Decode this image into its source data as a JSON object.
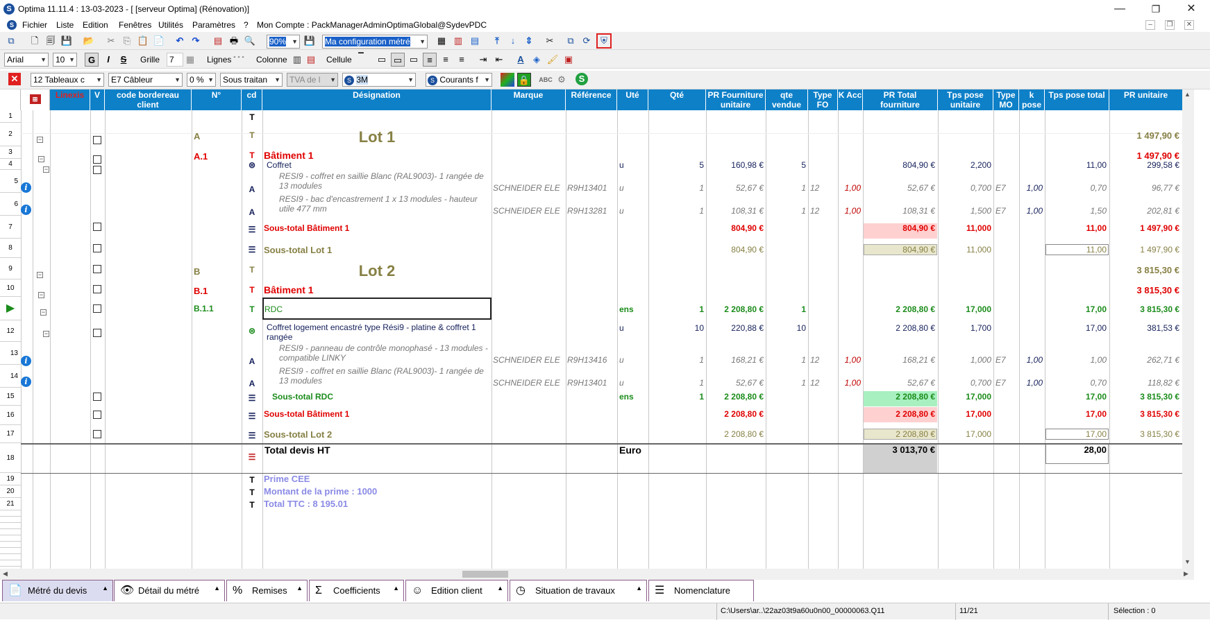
{
  "window": {
    "title": "Optima 11.11.4 : 13-03-2023 - [ [serveur Optima] (Rénovation)]",
    "minimize": "—",
    "maximize": "❐",
    "close": "✕"
  },
  "menu": [
    "Fichier",
    "Liste",
    "Edition",
    "Fenêtres",
    "Utilités",
    "Paramètres",
    "?"
  ],
  "account": "Mon Compte : PackManagerAdminOptimaGlobal@SydevPDC",
  "toolbar1": {
    "zoom": "90%",
    "config": "Ma configuration métré"
  },
  "toolbar2": {
    "font": "Arial",
    "size": "10",
    "bold": "G",
    "italic": "I",
    "strike": "S",
    "grille_label": "Grille",
    "grille_value": "7",
    "lignes_label": "Lignes",
    "colonne_label": "Colonne",
    "cellule_label": "Cellule"
  },
  "toolbar3": {
    "filter1": "12  Tableaux c",
    "filter2": "E7  Câbleur",
    "filter3": "0 %",
    "filter4": "Sous traitan",
    "filter5": "TVA de l",
    "filter6": "3M",
    "filter7": "Courants f"
  },
  "headers": {
    "linexis": "Linexis",
    "v": "V",
    "code": "code bordereau client",
    "num": "N°",
    "cd": "cd",
    "designation": "Désignation",
    "marque": "Marque",
    "reference": "Référence",
    "ute": "Uté",
    "qte": "Qté",
    "pr_fourn": "PR Fourniture unitaire",
    "qte_vendue": "qte vendue",
    "type_fo": "Type FO",
    "k_acc": "K Acc",
    "pr_total": "PR Total fourniture",
    "tps_pose_u": "Tps pose unitaire",
    "type_mo": "Type MO",
    "k_pose": "k pose",
    "tps_pose_total": "Tps pose total",
    "pr_unitaire": "PR unitaire"
  },
  "rows": [
    {
      "rn": "1",
      "icon": "T"
    },
    {
      "rn": "2",
      "num": "A",
      "designation": "Lot 1",
      "pr": "1 497,90 €"
    },
    {
      "rn": "3",
      "num": "A.1",
      "designation": "Bâtiment 1",
      "pr": "1 497,90 €"
    },
    {
      "rn": "4",
      "designation": "Coffret",
      "ute": "u",
      "qte": "5",
      "pr_fourn": "160,98 €",
      "qte_vendue": "5",
      "pr_total": "804,90 €",
      "tps_pose_u": "2,200",
      "tps_total": "11,00",
      "pr": "299,58 €"
    },
    {
      "rn": "5",
      "designation": "RESI9 - coffret en saillie Blanc (RAL9003)- 1 rangée de 13 modules",
      "marque": "SCHNEIDER ELE",
      "reference": "R9H13401",
      "ute": "u",
      "qte": "1",
      "pr_fourn": "52,67 €",
      "qte_vendue": "1",
      "type_fo": "12",
      "k_acc": "1,00",
      "pr_total": "52,67 €",
      "tps_pose_u": "0,700",
      "type_mo": "E7",
      "k_pose": "1,00",
      "tps_total": "0,70",
      "pr": "96,77 €"
    },
    {
      "rn": "6",
      "designation": "RESI9 - bac d'encastrement 1 x 13 modules - hauteur utile 477 mm",
      "marque": "SCHNEIDER ELE",
      "reference": "R9H13281",
      "ute": "u",
      "qte": "1",
      "pr_fourn": "108,31 €",
      "qte_vendue": "1",
      "type_fo": "12",
      "k_acc": "1,00",
      "pr_total": "108,31 €",
      "tps_pose_u": "1,500",
      "type_mo": "E7",
      "k_pose": "1,00",
      "tps_total": "1,50",
      "pr": "202,81 €"
    },
    {
      "rn": "7",
      "designation": "Sous-total Bâtiment 1",
      "pr_fourn": "804,90 €",
      "pr_total": "804,90 €",
      "tps_pose_u": "11,000",
      "tps_total": "11,00",
      "pr": "1 497,90 €"
    },
    {
      "rn": "8",
      "designation": "Sous-total Lot 1",
      "pr_fourn": "804,90 €",
      "pr_total": "804,90 €",
      "tps_pose_u": "11,000",
      "tps_total": "11,00",
      "pr": "1 497,90 €"
    },
    {
      "rn": "9",
      "num": "B",
      "designation": "Lot 2",
      "pr": "3 815,30 €"
    },
    {
      "rn": "10",
      "num": "B.1",
      "designation": "Bâtiment 1",
      "pr": "3 815,30 €"
    },
    {
      "rn": "11",
      "num": "B.1.1",
      "designation": "RDC",
      "ute": "ens",
      "qte": "1",
      "pr_fourn": "2 208,80 €",
      "qte_vendue": "1",
      "pr_total": "2 208,80 €",
      "tps_pose_u": "17,000",
      "tps_total": "17,00",
      "pr": "3 815,30 €"
    },
    {
      "rn": "12",
      "designation": "Coffret logement encastré type Rési9 - platine & coffret 1 rangée",
      "ute": "u",
      "qte": "10",
      "pr_fourn": "220,88 €",
      "qte_vendue": "10",
      "pr_total": "2 208,80 €",
      "tps_pose_u": "1,700",
      "tps_total": "17,00",
      "pr": "381,53 €"
    },
    {
      "rn": "13",
      "designation": "RESI9 - panneau de contrôle monophasé - 13 modules - compatible LINKY",
      "marque": "SCHNEIDER ELE",
      "reference": "R9H13416",
      "ute": "u",
      "qte": "1",
      "pr_fourn": "168,21 €",
      "qte_vendue": "1",
      "type_fo": "12",
      "k_acc": "1,00",
      "pr_total": "168,21 €",
      "tps_pose_u": "1,000",
      "type_mo": "E7",
      "k_pose": "1,00",
      "tps_total": "1,00",
      "pr": "262,71 €"
    },
    {
      "rn": "14",
      "designation": "RESI9 - coffret en saillie Blanc (RAL9003)- 1 rangée de 13 modules",
      "marque": "SCHNEIDER ELE",
      "reference": "R9H13401",
      "ute": "u",
      "qte": "1",
      "pr_fourn": "52,67 €",
      "qte_vendue": "1",
      "type_fo": "12",
      "k_acc": "1,00",
      "pr_total": "52,67 €",
      "tps_pose_u": "0,700",
      "type_mo": "E7",
      "k_pose": "1,00",
      "tps_total": "0,70",
      "pr": "118,82 €"
    },
    {
      "rn": "15",
      "designation": "Sous-total RDC",
      "ute": "ens",
      "qte": "1",
      "pr_fourn": "2 208,80 €",
      "pr_total": "2 208,80 €",
      "tps_pose_u": "17,000",
      "tps_total": "17,00",
      "pr": "3 815,30 €"
    },
    {
      "rn": "16",
      "designation": "Sous-total Bâtiment 1",
      "pr_fourn": "2 208,80 €",
      "pr_total": "2 208,80 €",
      "tps_pose_u": "17,000",
      "tps_total": "17,00",
      "pr": "3 815,30 €"
    },
    {
      "rn": "17",
      "designation": "Sous-total Lot 2",
      "pr_fourn": "2 208,80 €",
      "pr_total": "2 208,80 €",
      "tps_pose_u": "17,000",
      "tps_total": "17,00",
      "pr": "3 815,30 €"
    },
    {
      "rn": "18",
      "designation": "Total devis HT",
      "ute": "Euro",
      "pr_total": "3 013,70 €",
      "tps_total": "28,00"
    },
    {
      "rn": "19",
      "designation": "Prime CEE"
    },
    {
      "rn": "20",
      "designation": "Montant  de la prime : 1000"
    },
    {
      "rn": "21",
      "designation": "Total TTC : 8 195.01"
    }
  ],
  "tabs": [
    "Métré du devis",
    "Détail du métré",
    "Remises",
    "Coefficients",
    "Edition client",
    "Situation de travaux",
    "Nomenclature"
  ],
  "status": {
    "path": "C:\\Users\\ar..\\22az03t9a60u0n00_00000063.Q11",
    "position": "11/21",
    "selection": "Sélection : 0"
  },
  "colors": {
    "header": "#0e80c8",
    "lot": "#868044",
    "batiment": "#e00000",
    "rdc": "#1b8c1b"
  }
}
